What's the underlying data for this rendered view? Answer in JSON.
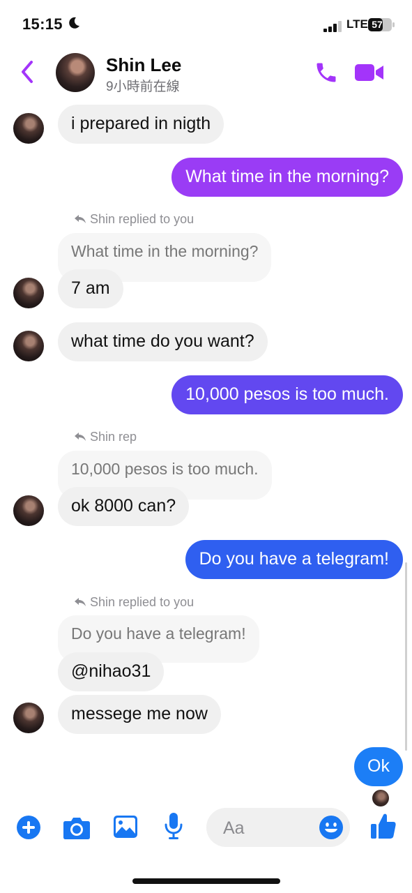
{
  "status_bar": {
    "time": "15:15",
    "network": "LTE",
    "battery": "57"
  },
  "header": {
    "name": "Shin Lee",
    "status": "9小時前在線"
  },
  "messages": [
    {
      "text": "i prepared in nigth"
    },
    {
      "text": "What time in the morning?"
    },
    {
      "reply_label": "Shin replied to you",
      "quote": "What time in the morning?"
    },
    {
      "text": "7 am"
    },
    {
      "text": "what time do you want?"
    },
    {
      "text": "10,000 pesos is too much."
    },
    {
      "reply_label": "Shin rep",
      "quote": "10,000 pesos is too much."
    },
    {
      "text": "ok 8000 can?"
    },
    {
      "text": "Do you have a telegram!"
    },
    {
      "reply_label": "Shin replied to you",
      "quote": "Do you have a telegram!"
    },
    {
      "text": "@nihao31"
    },
    {
      "text": "messege me now"
    },
    {
      "text": "Ok"
    }
  ],
  "composer": {
    "placeholder": "Aa"
  },
  "colors": {
    "accent": "#a334fa",
    "blue": "#1877f2",
    "bubble_purple": "#9a3cf5",
    "bubble_indigo": "#6248f0",
    "bubble_blue": "#2f5ff0",
    "bubble_light": "#1c7ef6"
  }
}
